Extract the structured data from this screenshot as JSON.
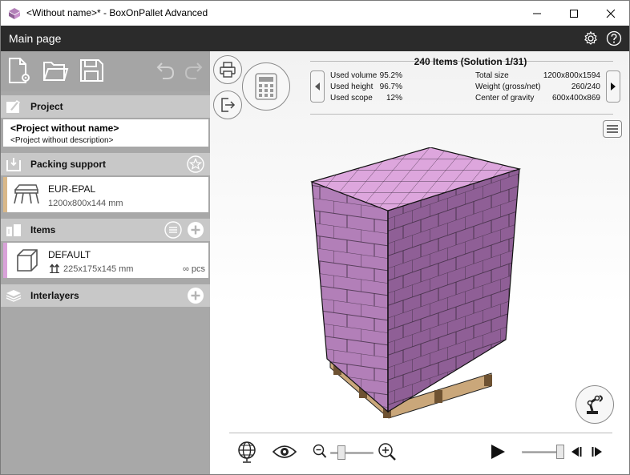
{
  "window": {
    "title": "<Without name>* - BoxOnPallet Advanced",
    "controls": [
      "minimize",
      "maximize",
      "close"
    ]
  },
  "header": {
    "page_title": "Main page",
    "icons": [
      "settings-icon",
      "help-icon"
    ]
  },
  "toolbar": {
    "icons": [
      "new-project-icon",
      "open-folder-icon",
      "save-icon",
      "undo-icon",
      "redo-icon"
    ]
  },
  "project": {
    "section_title": "Project",
    "name": "<Project without name>",
    "description": "<Project without description>"
  },
  "packing_support": {
    "section_title": "Packing support",
    "name": "EUR-EPAL",
    "size": "1200x800x144 mm",
    "bar_color": "#d9b889"
  },
  "items": {
    "section_title": "Items",
    "name": "DEFAULT",
    "size": "225x175x145 mm",
    "quantity": "∞ pcs",
    "bar_color": "#d9a2d9"
  },
  "interlayers": {
    "section_title": "Interlayers"
  },
  "solution": {
    "title": "240 Items (Solution 1/31)",
    "left_stats": [
      {
        "label": "Used volume",
        "value": "95.2%"
      },
      {
        "label": "Used height",
        "value": "96.7%"
      },
      {
        "label": "Used scope",
        "value": "12%"
      }
    ],
    "right_stats": [
      {
        "label": "Total size",
        "value": "1200x800x1594"
      },
      {
        "label": "Weight (gross/net)",
        "value": "260/240"
      },
      {
        "label": "Center of gravity",
        "value": "600x400x869"
      }
    ]
  },
  "playback": {
    "zoom_level": 0.2,
    "timeline_position": 1.0
  },
  "colors": {
    "box_top": "#dda6dd",
    "box_front": "#b27fb8",
    "box_side": "#8f5f96",
    "pallet": "#caa77a",
    "dark_header": "#2b2b2b",
    "panel": "#a8a8a8",
    "section_header": "#c8c8c8"
  }
}
